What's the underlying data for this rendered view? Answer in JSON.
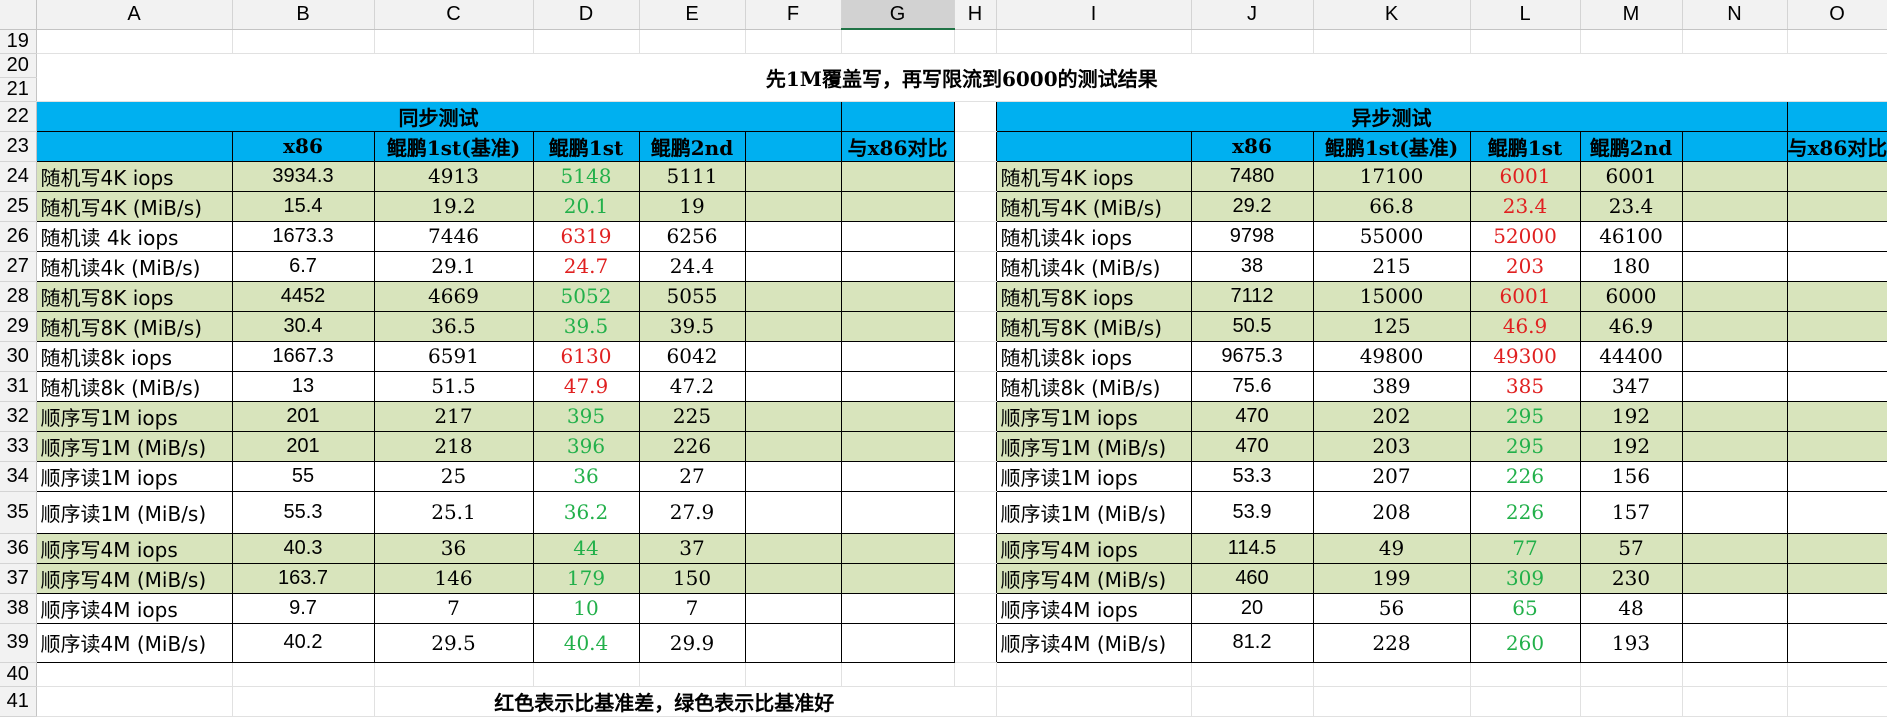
{
  "spreadsheet": {
    "columns": [
      "A",
      "B",
      "C",
      "D",
      "E",
      "F",
      "G",
      "H",
      "I",
      "J",
      "K",
      "L",
      "M",
      "N",
      "O"
    ],
    "selected_column": "G",
    "row_numbers": [
      "19",
      "20",
      "21",
      "22",
      "23",
      "24",
      "25",
      "26",
      "27",
      "28",
      "29",
      "30",
      "31",
      "32",
      "33",
      "34",
      "35",
      "36",
      "37",
      "38",
      "39",
      "40",
      "41"
    ]
  },
  "title": "先1M覆盖写，再写限流到6000的测试结果",
  "sync": {
    "section_label": "同步测试",
    "headers": [
      "x86",
      "鲲鹏1st(基准)",
      "鲲鹏1st",
      "鲲鹏2nd",
      "",
      "与x86对比"
    ],
    "rows": [
      {
        "label": "随机写4K iops",
        "x86": "3934.3",
        "base": "4913",
        "k1": "5148",
        "k1_color": "green",
        "k2": "5111"
      },
      {
        "label": "随机写4K (MiB/s)",
        "x86": "15.4",
        "base": "19.2",
        "k1": "20.1",
        "k1_color": "green",
        "k2": "19"
      },
      {
        "label": "随机读 4k iops",
        "x86": "1673.3",
        "base": "7446",
        "k1": "6319",
        "k1_color": "red",
        "k2": "6256"
      },
      {
        "label": "随机读4k (MiB/s)",
        "x86": "6.7",
        "base": "29.1",
        "k1": "24.7",
        "k1_color": "red",
        "k2": "24.4"
      },
      {
        "label": "随机写8K iops",
        "x86": "4452",
        "base": "4669",
        "k1": "5052",
        "k1_color": "green",
        "k2": "5055"
      },
      {
        "label": "随机写8K (MiB/s)",
        "x86": "30.4",
        "base": "36.5",
        "k1": "39.5",
        "k1_color": "green",
        "k2": "39.5"
      },
      {
        "label": "随机读8k iops",
        "x86": "1667.3",
        "base": "6591",
        "k1": "6130",
        "k1_color": "red",
        "k2": "6042"
      },
      {
        "label": "随机读8k (MiB/s)",
        "x86": "13",
        "base": "51.5",
        "k1": "47.9",
        "k1_color": "red",
        "k2": "47.2"
      },
      {
        "label": "顺序写1M iops",
        "x86": "201",
        "base": "217",
        "k1": "395",
        "k1_color": "green",
        "k2": "225"
      },
      {
        "label": "顺序写1M (MiB/s)",
        "x86": "201",
        "base": "218",
        "k1": "396",
        "k1_color": "green",
        "k2": "226"
      },
      {
        "label": "顺序读1M iops",
        "x86": "55",
        "base": "25",
        "k1": "36",
        "k1_color": "green",
        "k2": "27"
      },
      {
        "label": "顺序读1M (MiB/s)",
        "x86": "55.3",
        "base": "25.1",
        "k1": "36.2",
        "k1_color": "green",
        "k2": "27.9"
      },
      {
        "label": "顺序写4M iops",
        "x86": "40.3",
        "base": "36",
        "k1": "44",
        "k1_color": "green",
        "k2": "37"
      },
      {
        "label": "顺序写4M (MiB/s)",
        "x86": "163.7",
        "base": "146",
        "k1": "179",
        "k1_color": "green",
        "k2": "150"
      },
      {
        "label": "顺序读4M iops",
        "x86": "9.7",
        "base": "7",
        "k1": "10",
        "k1_color": "green",
        "k2": "7"
      },
      {
        "label": "顺序读4M (MiB/s)",
        "x86": "40.2",
        "base": "29.5",
        "k1": "40.4",
        "k1_color": "green",
        "k2": "29.9"
      }
    ]
  },
  "async": {
    "section_label": "异步测试",
    "headers": [
      "x86",
      "鲲鹏1st(基准)",
      "鲲鹏1st",
      "鲲鹏2nd",
      "",
      "与x86对比"
    ],
    "rows": [
      {
        "label": "随机写4K iops",
        "x86": "7480",
        "base": "17100",
        "k1": "6001",
        "k1_color": "red",
        "k2": "6001"
      },
      {
        "label": "随机写4K (MiB/s)",
        "x86": "29.2",
        "base": "66.8",
        "k1": "23.4",
        "k1_color": "red",
        "k2": "23.4"
      },
      {
        "label": "随机读4k iops",
        "x86": "9798",
        "base": "55000",
        "k1": "52000",
        "k1_color": "red",
        "k2": "46100"
      },
      {
        "label": "随机读4k  (MiB/s)",
        "x86": "38",
        "base": "215",
        "k1": "203",
        "k1_color": "red",
        "k2": "180"
      },
      {
        "label": "随机写8K iops",
        "x86": "7112",
        "base": "15000",
        "k1": "6001",
        "k1_color": "red",
        "k2": "6000"
      },
      {
        "label": "随机写8K (MiB/s)",
        "x86": "50.5",
        "base": "125",
        "k1": "46.9",
        "k1_color": "red",
        "k2": "46.9"
      },
      {
        "label": "随机读8k iops",
        "x86": "9675.3",
        "base": "49800",
        "k1": "49300",
        "k1_color": "red",
        "k2": "44400"
      },
      {
        "label": "随机读8k (MiB/s)",
        "x86": "75.6",
        "base": "389",
        "k1": "385",
        "k1_color": "red",
        "k2": "347"
      },
      {
        "label": "顺序写1M iops",
        "x86": "470",
        "base": "202",
        "k1": "295",
        "k1_color": "green",
        "k2": "192"
      },
      {
        "label": "顺序写1M (MiB/s)",
        "x86": "470",
        "base": "203",
        "k1": "295",
        "k1_color": "green",
        "k2": "192"
      },
      {
        "label": "顺序读1M iops",
        "x86": "53.3",
        "base": "207",
        "k1": "226",
        "k1_color": "green",
        "k2": "156"
      },
      {
        "label": "顺序读1M (MiB/s)",
        "x86": "53.9",
        "base": "208",
        "k1": "226",
        "k1_color": "green",
        "k2": "157"
      },
      {
        "label": "顺序写4M iops",
        "x86": "114.5",
        "base": "49",
        "k1": "77",
        "k1_color": "green",
        "k2": "57"
      },
      {
        "label": "顺序写4M (MiB/s)",
        "x86": "460",
        "base": "199",
        "k1": "309",
        "k1_color": "green",
        "k2": "230"
      },
      {
        "label": "顺序读4M iops",
        "x86": "20",
        "base": "56",
        "k1": "65",
        "k1_color": "green",
        "k2": "48"
      },
      {
        "label": "顺序读4M (MiB/s)",
        "x86": "81.2",
        "base": "228",
        "k1": "260",
        "k1_color": "green",
        "k2": "193"
      }
    ]
  },
  "note": "红色表示比基准差，绿色表示比基准好",
  "colors": {
    "section_header_bg": "#00b0f0",
    "highlight_row_bg": "#d8e4bc",
    "worse_text": "#e02020",
    "better_text": "#22b04a",
    "selected_column_accent": "#217346"
  }
}
